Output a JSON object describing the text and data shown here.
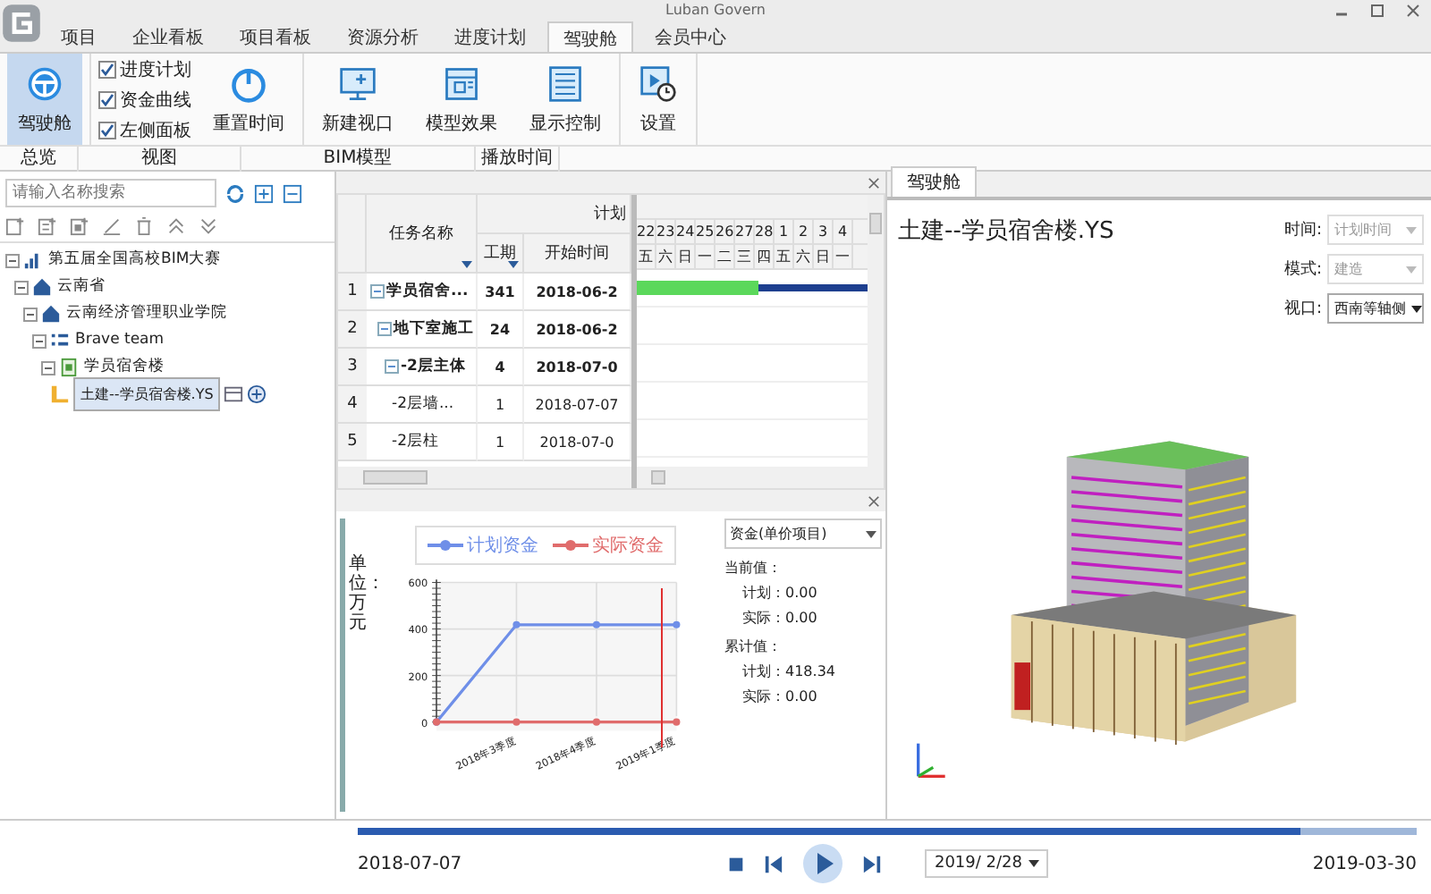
{
  "window": {
    "title": "Luban Govern"
  },
  "tabs": [
    {
      "label": "项目",
      "selected": false
    },
    {
      "label": "企业看板",
      "selected": false
    },
    {
      "label": "项目看板",
      "selected": false
    },
    {
      "label": "资源分析",
      "selected": false
    },
    {
      "label": "进度计划",
      "selected": false
    },
    {
      "label": "驾驶舱",
      "selected": true
    },
    {
      "label": "会员中心",
      "selected": false
    }
  ],
  "ribbon": [
    {
      "label": "总览",
      "items": [
        {
          "kind": "big",
          "label": "驾驶舱",
          "selected": true
        }
      ]
    },
    {
      "label": "视图",
      "items": [
        {
          "kind": "checkbox",
          "label": "进度计划",
          "checked": true
        },
        {
          "kind": "checkbox",
          "label": "资金曲线",
          "checked": true
        },
        {
          "kind": "checkbox",
          "label": "左侧面板",
          "checked": true
        },
        {
          "kind": "big",
          "label": "重置时间",
          "selected": false
        }
      ]
    },
    {
      "label": "BIM模型",
      "items": [
        {
          "kind": "big",
          "label": "新建视口",
          "selected": false
        },
        {
          "kind": "big",
          "label": "模型效果",
          "selected": false
        },
        {
          "kind": "big",
          "label": "显示控制",
          "selected": false
        }
      ]
    },
    {
      "label": "播放时间",
      "items": [
        {
          "kind": "big",
          "label": "设置",
          "selected": false
        }
      ]
    }
  ],
  "sidebar": {
    "search": {
      "placeholder": "请输入名称搜索"
    },
    "tree": [
      {
        "label": "第五届全国高校BIM大赛",
        "expanded": true,
        "selected": false,
        "children": [
          {
            "label": "云南省",
            "expanded": true,
            "selected": false,
            "children": [
              {
                "label": "云南经济管理职业学院",
                "expanded": true,
                "selected": false,
                "children": [
                  {
                    "label": "Brave team",
                    "expanded": true,
                    "selected": false,
                    "children": [
                      {
                        "label": "学员宿舍楼",
                        "expanded": true,
                        "selected": false,
                        "children": [
                          {
                            "label": "土建--学员宿舍楼.YS",
                            "selected": true
                          }
                        ]
                      }
                    ]
                  }
                ]
              }
            ]
          }
        ]
      }
    ]
  },
  "gantt": {
    "columns": {
      "name": "任务名称",
      "group": "计划",
      "duration": "工期",
      "start": "开始时间"
    },
    "days": [
      {
        "day": "22",
        "weekday": "五"
      },
      {
        "day": "23",
        "weekday": "六"
      },
      {
        "day": "24",
        "weekday": "日"
      },
      {
        "day": "25",
        "weekday": "一"
      },
      {
        "day": "26",
        "weekday": "二"
      },
      {
        "day": "27",
        "weekday": "三"
      },
      {
        "day": "28",
        "weekday": "四"
      },
      {
        "day": "1",
        "weekday": "五"
      },
      {
        "day": "2",
        "weekday": "六"
      },
      {
        "day": "3",
        "weekday": "日"
      },
      {
        "day": "4",
        "weekday": "一"
      }
    ],
    "rows": [
      {
        "no": "1",
        "name": "学员宿舍...",
        "duration": "341",
        "start": "2018-06-2",
        "bold": true,
        "expanded": true,
        "level": 0.53
      },
      {
        "no": "2",
        "name": "地下室施工",
        "duration": "24",
        "start": "2018-06-2",
        "bold": true,
        "expanded": true
      },
      {
        "no": "3",
        "name": "-2层主体",
        "duration": "4",
        "start": "2018-07-0",
        "bold": true,
        "expanded": true
      },
      {
        "no": "4",
        "name": "-2层墙...",
        "duration": "1",
        "start": "2018-07-07",
        "bold": false
      },
      {
        "no": "5",
        "name": "-2层柱",
        "duration": "1",
        "start": "2018-07-0",
        "bold": false
      }
    ]
  },
  "funds": {
    "unit": "单位：万元",
    "chart_data": {
      "type": "line",
      "legend": "top",
      "categories": [
        null,
        "2018年3季度",
        "2018年4季度",
        "2019年1季度"
      ],
      "ylim": [
        0,
        600
      ],
      "yticks": [
        0,
        200,
        400,
        600
      ],
      "series": [
        {
          "name": "计划资金",
          "color": "#6f8fe8",
          "marker": "o",
          "values": [
            0,
            418.34,
            418.34,
            418.34
          ]
        },
        {
          "name": "实际资金",
          "color": "#e06c6c",
          "marker": "o",
          "values": [
            0,
            0,
            0,
            0
          ]
        }
      ]
    },
    "dropdown": "资金(单价项目)",
    "current_label": "当前值：",
    "current": [
      "计划：0.00",
      "实际：0.00"
    ],
    "total_label": "累计值：",
    "total": [
      "计划：418.34",
      "实际：0.00"
    ]
  },
  "viewer": {
    "tab": "驾驶舱",
    "title": "土建--学员宿舍楼.YS",
    "fields": [
      {
        "label": "时间:",
        "value": "计划时间",
        "disabled": true
      },
      {
        "label": "模式:",
        "value": "建造",
        "disabled": true
      },
      {
        "label": "视口:",
        "value": "西南等轴侧",
        "disabled": false
      }
    ]
  },
  "timeline": {
    "level": 0.89,
    "start": "2018-07-07",
    "end": "2019-03-30",
    "date": "2019/ 2/28"
  }
}
